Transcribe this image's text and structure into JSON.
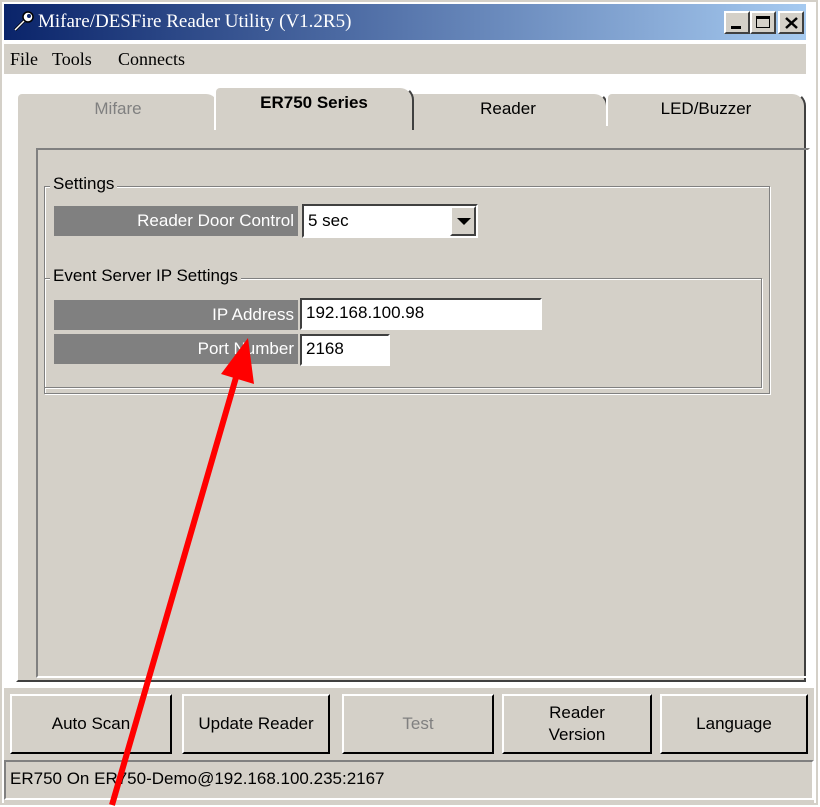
{
  "window": {
    "title": "Mifare/DESFire Reader Utility (V1.2R5)",
    "controls": [
      "minimize-icon",
      "maximize-icon",
      "close-icon"
    ]
  },
  "menu": {
    "items": [
      "File",
      "Tools",
      "Connects"
    ]
  },
  "tabs": [
    {
      "label": "Mifare",
      "state": "disabled"
    },
    {
      "label": "ER750 Series",
      "state": "active"
    },
    {
      "label": "Reader",
      "state": "normal"
    },
    {
      "label": "LED/Buzzer",
      "state": "normal"
    }
  ],
  "settings": {
    "group_label": "Settings",
    "door_control": {
      "label": "Reader Door Control",
      "value": "5 sec"
    },
    "event_server": {
      "group_label": "Event Server IP Settings",
      "ip_address": {
        "label": "IP Address",
        "value": "192.168.100.98"
      },
      "port_number": {
        "label": "Port Number",
        "value": "2168"
      }
    }
  },
  "buttons": {
    "auto_scan": "Auto Scan",
    "update_reader": "Update Reader",
    "test": "Test",
    "reader_version_line1": "Reader",
    "reader_version_line2": "Version",
    "language": "Language"
  },
  "status": {
    "text": "ER750 On ER750-Demo@192.168.100.235:2167"
  },
  "annotation": {
    "arrow_color": "#ff0000"
  },
  "colors": {
    "title_start": "#0a246a",
    "title_end": "#a6caf0",
    "face": "#d4d0c8",
    "label_bg": "#808080"
  }
}
